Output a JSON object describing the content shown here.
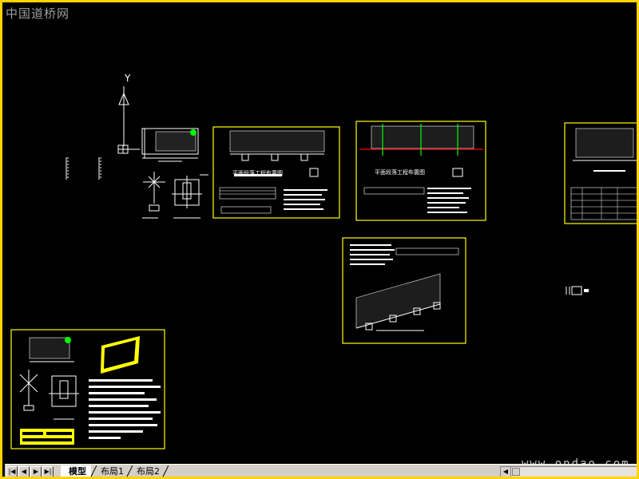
{
  "watermark": {
    "text": "中国道桥网"
  },
  "site_watermark": {
    "text": "www.ondao.com"
  },
  "axis": {
    "y_label": "Y"
  },
  "sheet_captions": {
    "sheet2": "平面段落工程布置图",
    "sheet3": "平面段落工程布置图"
  },
  "tabs": [
    {
      "label": "模型",
      "active": true
    },
    {
      "label": "布局1",
      "active": false
    },
    {
      "label": "布局2",
      "active": false
    }
  ],
  "nav": {
    "first": "|◀",
    "prev": "◀",
    "next": "▶",
    "last": "▶|"
  },
  "scroll": {
    "left_arrow": "◀"
  },
  "colors": {
    "frame": "#ffd400",
    "sheet_border": "#ffff00",
    "drawing": "#ffffff",
    "highlight_red": "#ff0000",
    "highlight_green": "#00ff00",
    "panel_yellow": "#ffff00",
    "background": "#000000"
  }
}
